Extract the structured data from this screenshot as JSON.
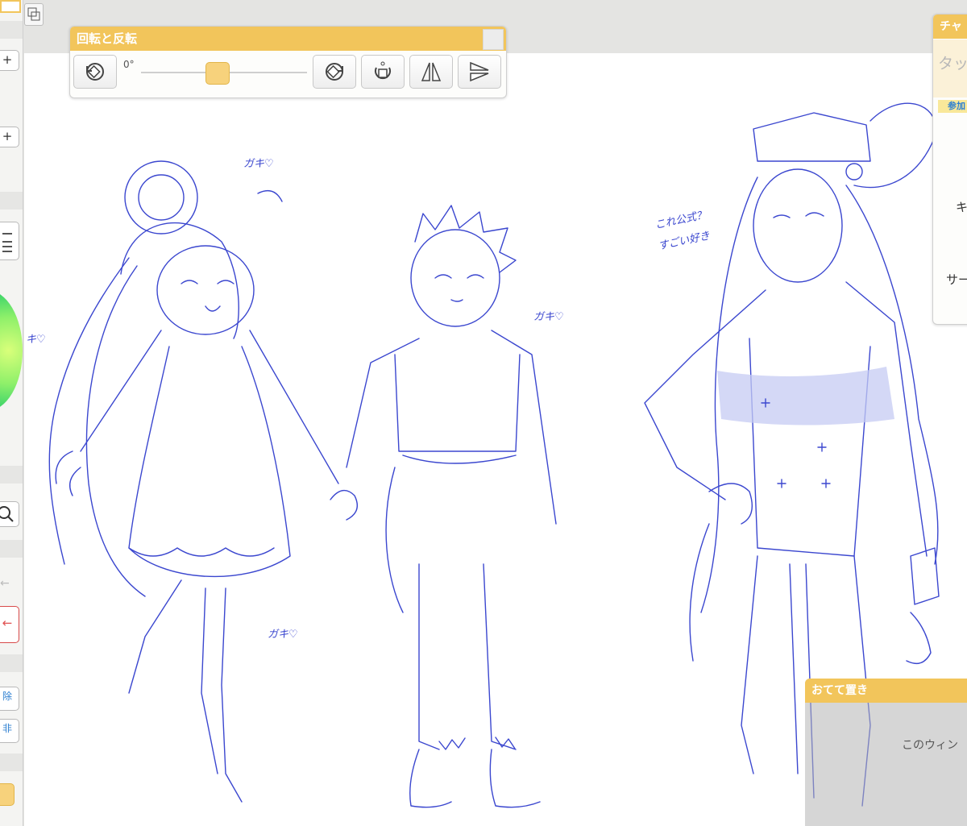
{
  "rotate_panel": {
    "title": "回転と反転",
    "angle_value": "0°",
    "angle_fraction": 0.5,
    "buttons": [
      "rotate-left",
      "rotate-right",
      "reset-rotation",
      "flip-horizontal",
      "flip-vertical"
    ]
  },
  "chat_panel": {
    "title": "チャ",
    "input_placeholder": "タッ",
    "badge": "参加",
    "line1": "キ",
    "line2": "サー"
  },
  "hand_panel": {
    "title": "おてて置き",
    "body": "このウィン"
  },
  "sidebar": {
    "plus1": "+",
    "plus2": "+",
    "btn_a": "除",
    "btn_b": "非"
  },
  "annotations": {
    "gaki1": "ガキ♡",
    "gaki2": "ガキ♡",
    "gaki3": "ガキ♡",
    "gaki_left": "キ♡",
    "comment_line1": "これ公式？",
    "comment_line2": "すごい好き"
  },
  "colors": {
    "accent": "#f2c55b",
    "ink": "#3b47cf",
    "panel_bg": "#fdfdfb"
  }
}
